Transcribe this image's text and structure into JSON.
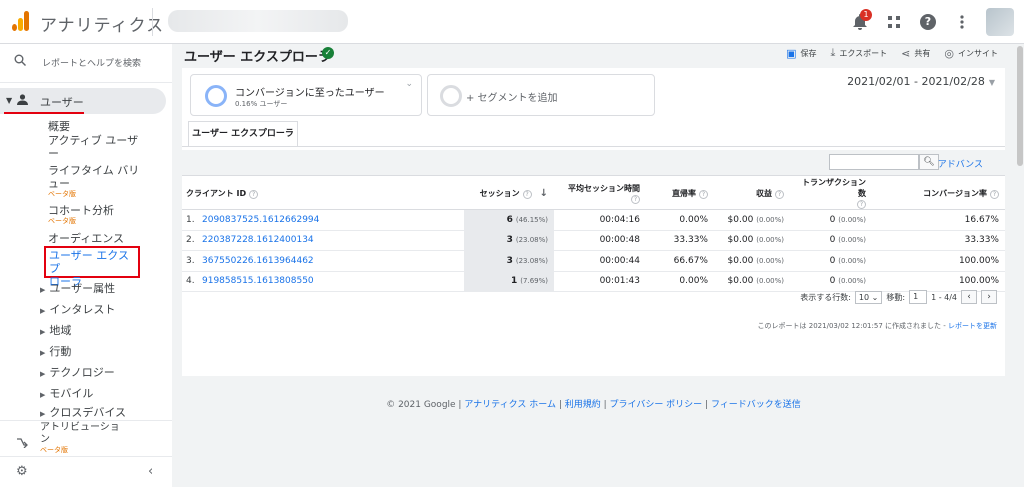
{
  "header": {
    "app_title": "アナリティクス",
    "notification_count": "1",
    "help_glyph": "?"
  },
  "sidebar": {
    "search_label": "レポートとヘルプを検索",
    "section_label": "ユーザー",
    "items": [
      {
        "label": "概要"
      },
      {
        "label": "アクティブ ユーザ\nー"
      },
      {
        "label": "ライフタイム バリ\nュー",
        "beta": "ベータ版"
      },
      {
        "label": "コホート分析",
        "beta": "ベータ版"
      },
      {
        "label": "オーディエンス"
      },
      {
        "label": "ユーザー エクスプ\nローラ"
      }
    ],
    "subsections": [
      "ユーザー属性",
      "インタレスト",
      "地域",
      "行動",
      "テクノロジー",
      "モバイル",
      "クロスデバイス"
    ],
    "attribution_label": "アトリビューショ\nン",
    "attribution_beta": "ベータ版"
  },
  "main": {
    "title": "ユーザー エクスプローラ",
    "actions": {
      "save": "保存",
      "export": "エクスポート",
      "share": "共有",
      "insight": "インサイト"
    },
    "segment": {
      "name": "コンバージョンに至ったユーザー",
      "sub": "0.16% ユーザー",
      "add": "+ セグメントを追加"
    },
    "date_range": "2021/02/01 - 2021/02/28",
    "tab": "ユーザー エクスプローラ",
    "advanced": "アドバンス",
    "columns": [
      "クライアント ID",
      "セッション",
      "平均セッション時間",
      "直帰率",
      "収益",
      "トランザクション数",
      "コンバージョン率"
    ],
    "rows": [
      {
        "idx": "1.",
        "id": "2090837525.1612662994",
        "sessions": "6",
        "sessions_pct": "(46.15%)",
        "duration": "00:04:16",
        "bounce": "0.00%",
        "revenue": "$0.00",
        "revenue_pct": "(0.00%)",
        "tx": "0",
        "tx_pct": "(0.00%)",
        "conv": "16.67%"
      },
      {
        "idx": "2.",
        "id": "220387228.1612400134",
        "sessions": "3",
        "sessions_pct": "(23.08%)",
        "duration": "00:00:48",
        "bounce": "33.33%",
        "revenue": "$0.00",
        "revenue_pct": "(0.00%)",
        "tx": "0",
        "tx_pct": "(0.00%)",
        "conv": "33.33%"
      },
      {
        "idx": "3.",
        "id": "367550226.1613964462",
        "sessions": "3",
        "sessions_pct": "(23.08%)",
        "duration": "00:00:44",
        "bounce": "66.67%",
        "revenue": "$0.00",
        "revenue_pct": "(0.00%)",
        "tx": "0",
        "tx_pct": "(0.00%)",
        "conv": "100.00%"
      },
      {
        "idx": "4.",
        "id": "919858515.1613808550",
        "sessions": "1",
        "sessions_pct": "(7.69%)",
        "duration": "00:01:43",
        "bounce": "0.00%",
        "revenue": "$0.00",
        "revenue_pct": "(0.00%)",
        "tx": "0",
        "tx_pct": "(0.00%)",
        "conv": "100.00%"
      }
    ],
    "pager": {
      "rows_label": "表示する行数:",
      "rows_value": "10",
      "goto_label": "移動:",
      "goto_value": "1",
      "range": "1 - 4/4"
    },
    "created": "このレポートは 2021/03/02 12:01:57 に作成されました -",
    "refresh": "レポートを更新"
  },
  "footer": {
    "copyright": "© 2021 Google |",
    "links": [
      "アナリティクス ホーム",
      "利用規約",
      "プライバシー ポリシー",
      "フィードバックを送信"
    ]
  }
}
